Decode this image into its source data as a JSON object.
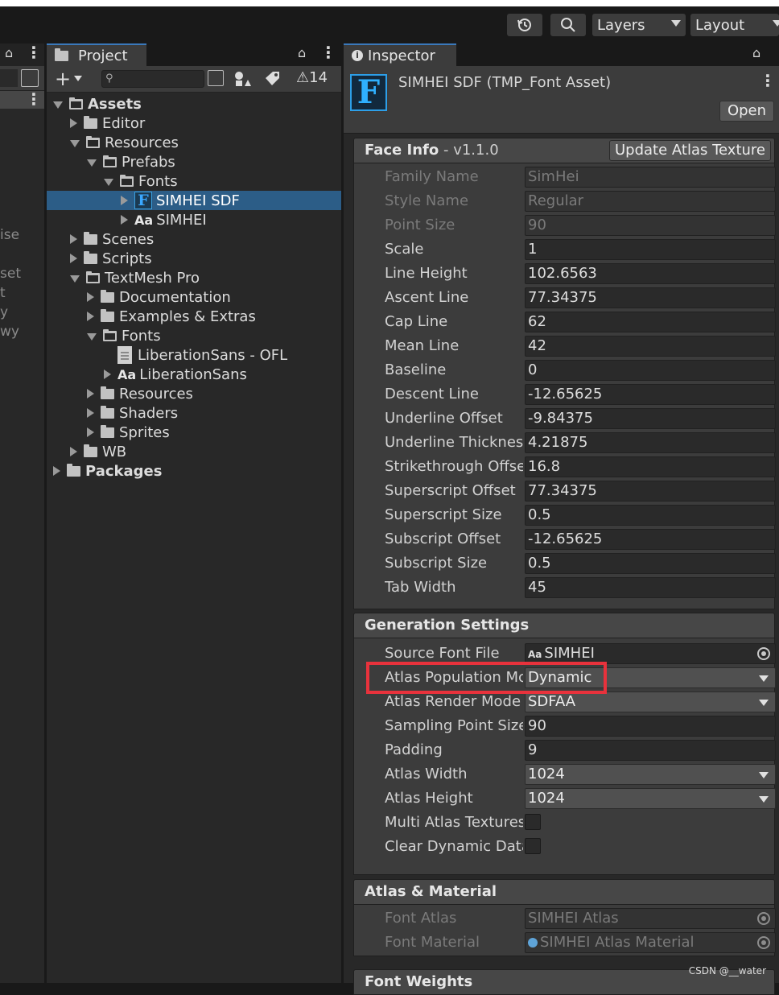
{
  "toolbar": {
    "layers_label": "Layers",
    "layout_label": "Layout"
  },
  "left_panel": {
    "cut_labels": [
      "ise",
      "set",
      "t",
      "y",
      "wy"
    ]
  },
  "project": {
    "tab_label": "Project",
    "hidden_count": "14",
    "search_placeholder": "",
    "tree": [
      {
        "label": "Assets",
        "depth": 0,
        "expand": "d",
        "icon": "folder-open",
        "bold": true
      },
      {
        "label": "Editor",
        "depth": 1,
        "expand": "r",
        "icon": "folder"
      },
      {
        "label": "Resources",
        "depth": 1,
        "expand": "d",
        "icon": "folder-open"
      },
      {
        "label": "Prefabs",
        "depth": 2,
        "expand": "d",
        "icon": "folder-open"
      },
      {
        "label": "Fonts",
        "depth": 3,
        "expand": "d",
        "icon": "folder-open"
      },
      {
        "label": "SIMHEI SDF",
        "depth": 4,
        "expand": "r",
        "icon": "font-asset",
        "selected": true
      },
      {
        "label": "SIMHEI",
        "depth": 4,
        "expand": "r",
        "icon": "font"
      },
      {
        "label": "Scenes",
        "depth": 1,
        "expand": "r",
        "icon": "folder"
      },
      {
        "label": "Scripts",
        "depth": 1,
        "expand": "r",
        "icon": "folder"
      },
      {
        "label": "TextMesh Pro",
        "depth": 1,
        "expand": "d",
        "icon": "folder-open"
      },
      {
        "label": "Documentation",
        "depth": 2,
        "expand": "r",
        "icon": "folder"
      },
      {
        "label": "Examples & Extras",
        "depth": 2,
        "expand": "r",
        "icon": "folder"
      },
      {
        "label": "Fonts",
        "depth": 2,
        "expand": "d",
        "icon": "folder-open"
      },
      {
        "label": "LiberationSans - OFL",
        "depth": 3,
        "expand": "none",
        "icon": "document"
      },
      {
        "label": "LiberationSans",
        "depth": 3,
        "expand": "r",
        "icon": "font"
      },
      {
        "label": "Resources",
        "depth": 2,
        "expand": "r",
        "icon": "folder"
      },
      {
        "label": "Shaders",
        "depth": 2,
        "expand": "r",
        "icon": "folder"
      },
      {
        "label": "Sprites",
        "depth": 2,
        "expand": "r",
        "icon": "folder"
      },
      {
        "label": "WB",
        "depth": 1,
        "expand": "r",
        "icon": "folder"
      },
      {
        "label": "Packages",
        "depth": 0,
        "expand": "r",
        "icon": "folder",
        "bold": true
      }
    ]
  },
  "inspector": {
    "tab_label": "Inspector",
    "asset_title": "SIMHEI SDF (TMP_Font Asset)",
    "open_label": "Open",
    "face_info": {
      "title": "Face Info",
      "version": " - v1.1.0",
      "update_label": "Update Atlas Texture",
      "rows": [
        {
          "label": "Family Name",
          "value": "SimHei",
          "disabled": true
        },
        {
          "label": "Style Name",
          "value": "Regular",
          "disabled": true
        },
        {
          "label": "Point Size",
          "value": "90",
          "disabled": true
        },
        {
          "label": "Scale",
          "value": "1"
        },
        {
          "label": "Line Height",
          "value": "102.6563"
        },
        {
          "label": "Ascent Line",
          "value": "77.34375"
        },
        {
          "label": "Cap Line",
          "value": "62"
        },
        {
          "label": "Mean Line",
          "value": "42"
        },
        {
          "label": "Baseline",
          "value": "0"
        },
        {
          "label": "Descent Line",
          "value": "-12.65625"
        },
        {
          "label": "Underline Offset",
          "value": "-9.84375"
        },
        {
          "label": "Underline Thicknes",
          "value": "4.21875"
        },
        {
          "label": "Strikethrough Offse",
          "value": "16.8"
        },
        {
          "label": "Superscript Offset",
          "value": "77.34375"
        },
        {
          "label": "Superscript Size",
          "value": "0.5"
        },
        {
          "label": "Subscript Offset",
          "value": "-12.65625"
        },
        {
          "label": "Subscript Size",
          "value": "0.5"
        },
        {
          "label": "Tab Width",
          "value": "45"
        }
      ]
    },
    "generation": {
      "title": "Generation Settings",
      "rows": [
        {
          "label": "Source Font File",
          "value": "SIMHEI",
          "kind": "object"
        },
        {
          "label": "Atlas Population Mc",
          "value": "Dynamic",
          "kind": "dropdown",
          "highlighted": true
        },
        {
          "label": "Atlas Render Mode",
          "value": "SDFAA",
          "kind": "dropdown"
        },
        {
          "label": "Sampling Point Size",
          "value": "90",
          "kind": "text"
        },
        {
          "label": "Padding",
          "value": "9",
          "kind": "text"
        },
        {
          "label": "Atlas Width",
          "value": "1024",
          "kind": "dropdown"
        },
        {
          "label": "Atlas Height",
          "value": "1024",
          "kind": "dropdown"
        },
        {
          "label": "Multi Atlas Textures",
          "value": "",
          "kind": "checkbox"
        },
        {
          "label": "Clear Dynamic Data",
          "value": "",
          "kind": "checkbox"
        }
      ]
    },
    "atlas_material": {
      "title": "Atlas & Material",
      "rows": [
        {
          "label": "Font Atlas",
          "value": "SIMHEI Atlas"
        },
        {
          "label": "Font Material",
          "value": "SIMHEI Atlas Material"
        }
      ]
    },
    "font_weights_title": "Font Weights"
  },
  "watermark": "CSDN @__water",
  "colors": {
    "selection": "#2c5d87",
    "highlight_box": "#e8323c",
    "tmp_icon": "#2fb0ff"
  }
}
